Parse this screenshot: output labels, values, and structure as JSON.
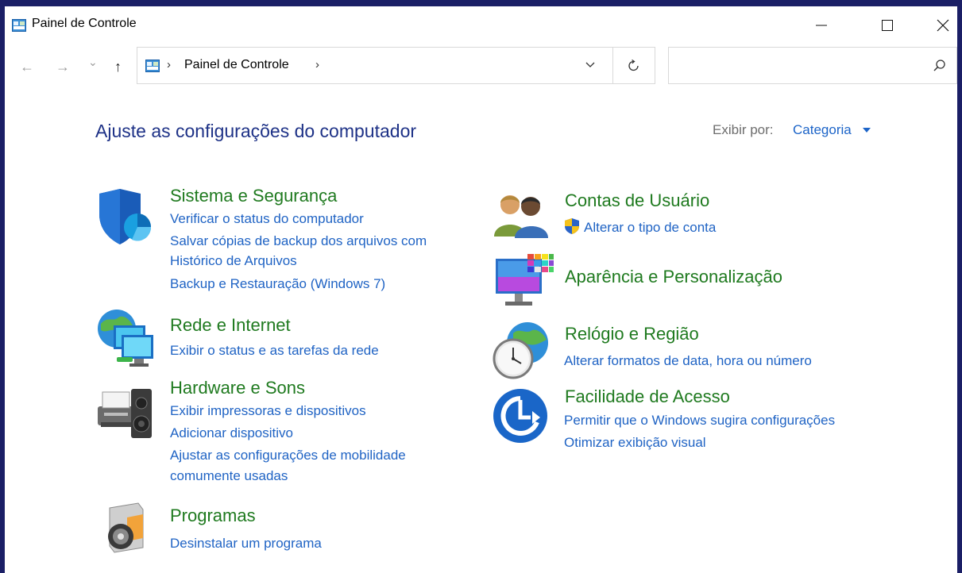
{
  "window": {
    "title": "Painel de Controle",
    "controls": {
      "minimize": "—",
      "maximize": "☐",
      "close": "✕"
    }
  },
  "nav": {
    "back": "←",
    "forward": "→",
    "recent": "⌄",
    "up": "↑",
    "address_separator": "›",
    "address_path": "Painel de Controle"
  },
  "content": {
    "heading": "Ajuste as configurações do computador",
    "view_by_label": "Exibir por:",
    "view_by_value": "Categoria"
  },
  "categories": {
    "sistema": {
      "title": "Sistema e Segurança",
      "links": [
        "Verificar o status do computador",
        "Salvar cópias de backup dos arquivos com",
        "Histórico de Arquivos",
        "Backup e Restauração (Windows 7)"
      ]
    },
    "rede": {
      "title": "Rede e Internet",
      "links": [
        "Exibir o status e as tarefas da rede"
      ]
    },
    "hardware": {
      "title": "Hardware e Sons",
      "links": [
        "Exibir impressoras e dispositivos",
        "Adicionar dispositivo",
        "Ajustar as configurações de mobilidade",
        "comumente usadas"
      ]
    },
    "programas": {
      "title": "Programas",
      "links": [
        "Desinstalar um programa"
      ]
    },
    "contas": {
      "title": "Contas de Usuário",
      "links": [
        "Alterar o tipo de conta"
      ]
    },
    "aparencia": {
      "title": "Aparência e Personalização",
      "links": []
    },
    "relogio": {
      "title": "Relógio e Região",
      "links": [
        "Alterar formatos de data, hora ou número"
      ]
    },
    "facilidade": {
      "title": "Facilidade de Acesso",
      "links": [
        "Permitir que o Windows sugira configurações",
        "Otimizar exibição visual"
      ]
    }
  },
  "colors": {
    "heading": "#1e3287",
    "category_title": "#1f7a1f",
    "link": "#1f63c4",
    "border": "#1b1f66"
  }
}
